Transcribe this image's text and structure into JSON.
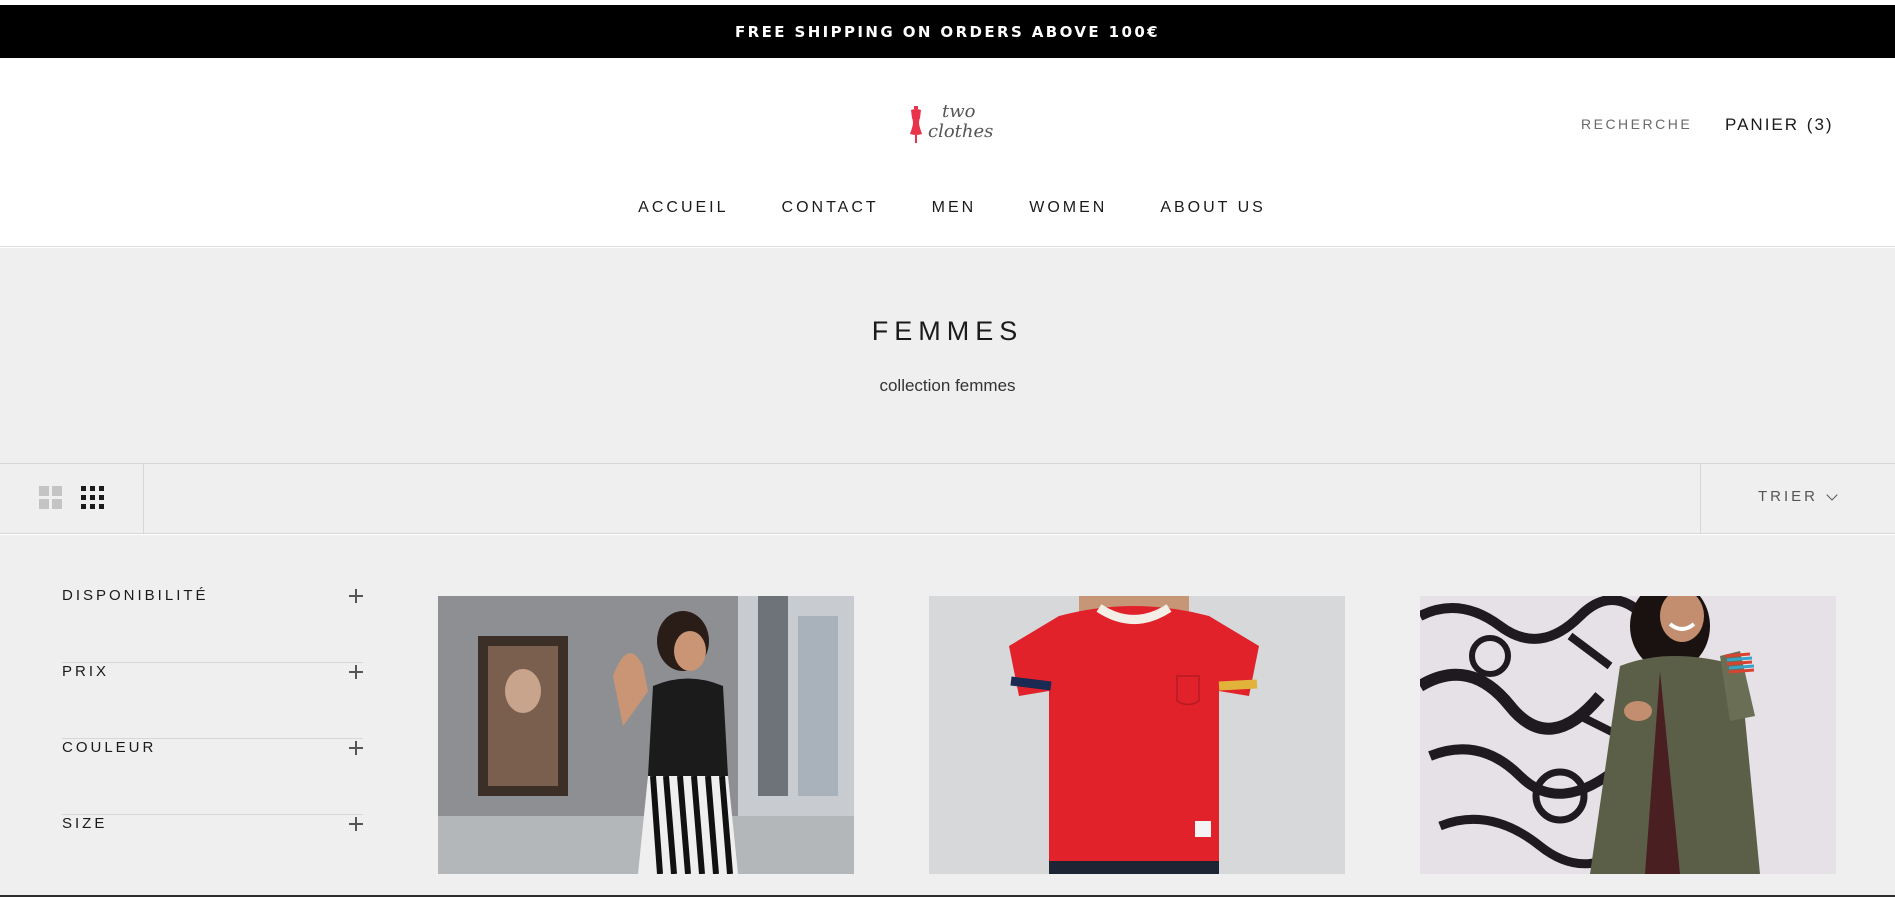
{
  "announcement": {
    "text": "FREE SHIPPING ON ORDERS ABOVE 100€"
  },
  "header": {
    "logo_line1": "two",
    "logo_line2": "clothes",
    "search_label": "RECHERCHE",
    "cart_label": "PANIER",
    "cart_count": "(3)"
  },
  "nav": {
    "items": [
      {
        "label": "ACCUEIL"
      },
      {
        "label": "CONTACT"
      },
      {
        "label": "MEN"
      },
      {
        "label": "WOMEN"
      },
      {
        "label": "ABOUT US"
      }
    ]
  },
  "collection": {
    "title": "FEMMES",
    "description": "collection femmes"
  },
  "toolbar": {
    "sort_label": "TRIER",
    "icons": [
      "grid-2-columns-icon",
      "grid-3-columns-icon"
    ]
  },
  "filters": {
    "items": [
      {
        "label": "DISPONIBILITÉ"
      },
      {
        "label": "PRIX"
      },
      {
        "label": "COULEUR"
      },
      {
        "label": "SIZE"
      }
    ]
  },
  "products": [
    {
      "image": "woman-black-top-striped-pants"
    },
    {
      "image": "red-tshirt"
    },
    {
      "image": "woman-green-jacket-graffiti"
    }
  ],
  "colors": {
    "announcement_bg": "#000000",
    "page_bg": "#efefef",
    "text": "#1c1b1b",
    "logo_accent": "#e8334a"
  }
}
